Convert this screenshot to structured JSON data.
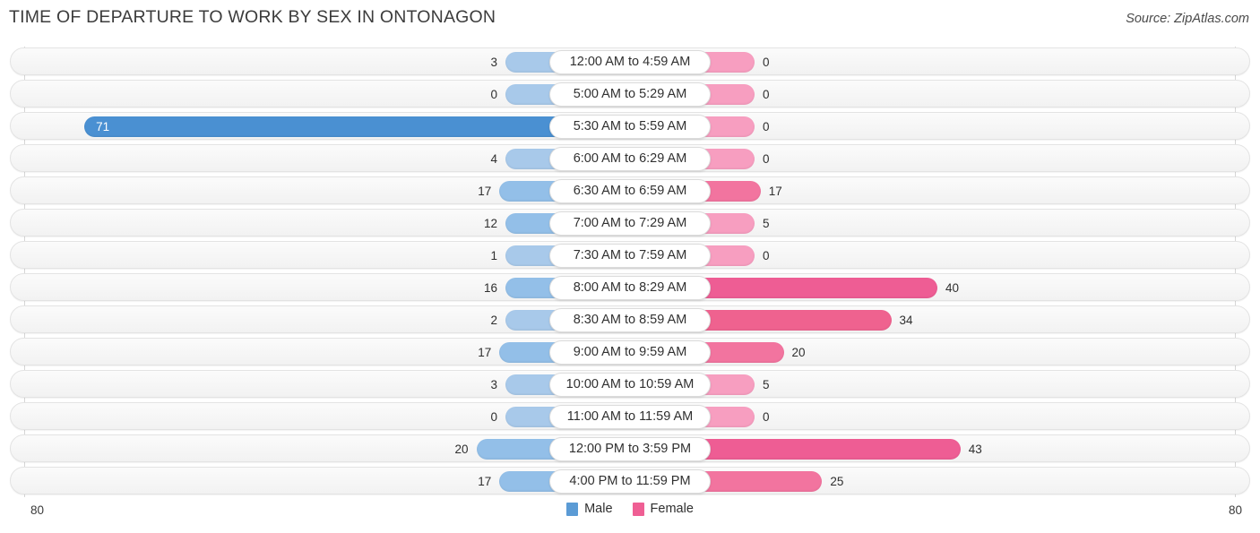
{
  "header": {
    "title": "TIME OF DEPARTURE TO WORK BY SEX IN ONTONAGON",
    "source": "Source: ZipAtlas.com"
  },
  "axis": {
    "left_label": "80",
    "right_label": "80"
  },
  "legend": {
    "items": [
      {
        "label": "Male",
        "color": "#5b9bd5"
      },
      {
        "label": "Female",
        "color": "#ef5f94"
      }
    ]
  },
  "chart_data": {
    "type": "bar",
    "subtype": "diverging-bidirectional",
    "title": "TIME OF DEPARTURE TO WORK BY SEX IN ONTONAGON",
    "xlabel": "",
    "ylabel": "",
    "xlim": [
      80,
      80
    ],
    "axis_max": 80,
    "grid": false,
    "legend_position": "bottom-center",
    "categories": [
      "12:00 AM to 4:59 AM",
      "5:00 AM to 5:29 AM",
      "5:30 AM to 5:59 AM",
      "6:00 AM to 6:29 AM",
      "6:30 AM to 6:59 AM",
      "7:00 AM to 7:29 AM",
      "7:30 AM to 7:59 AM",
      "8:00 AM to 8:29 AM",
      "8:30 AM to 8:59 AM",
      "9:00 AM to 9:59 AM",
      "10:00 AM to 10:59 AM",
      "11:00 AM to 11:59 AM",
      "12:00 PM to 3:59 PM",
      "4:00 PM to 11:59 PM"
    ],
    "series": [
      {
        "name": "Male",
        "direction": "left",
        "color": "#93bfe8",
        "values": [
          3,
          0,
          71,
          4,
          17,
          12,
          1,
          16,
          2,
          17,
          3,
          0,
          20,
          17
        ]
      },
      {
        "name": "Female",
        "direction": "right",
        "color": "#f79ec0",
        "values": [
          0,
          0,
          0,
          0,
          17,
          5,
          0,
          40,
          34,
          20,
          5,
          0,
          43,
          25
        ]
      }
    ]
  },
  "rows": [
    {
      "label": "12:00 AM to 4:59 AM",
      "male": 3,
      "female": 0,
      "male_color": "#a8c9ea",
      "female_color": "#f79ec0"
    },
    {
      "label": "5:00 AM to 5:29 AM",
      "male": 0,
      "female": 0,
      "male_color": "#a8c9ea",
      "female_color": "#f79ec0"
    },
    {
      "label": "5:30 AM to 5:59 AM",
      "male": 71,
      "female": 0,
      "male_color": "#4a90d2",
      "female_color": "#f79ec0"
    },
    {
      "label": "6:00 AM to 6:29 AM",
      "male": 4,
      "female": 0,
      "male_color": "#a8c9ea",
      "female_color": "#f79ec0"
    },
    {
      "label": "6:30 AM to 6:59 AM",
      "male": 17,
      "female": 17,
      "male_color": "#93bfe8",
      "female_color": "#f2749f"
    },
    {
      "label": "7:00 AM to 7:29 AM",
      "male": 12,
      "female": 5,
      "male_color": "#93bfe8",
      "female_color": "#f79ec0"
    },
    {
      "label": "7:30 AM to 7:59 AM",
      "male": 1,
      "female": 0,
      "male_color": "#a8c9ea",
      "female_color": "#f79ec0"
    },
    {
      "label": "8:00 AM to 8:29 AM",
      "male": 16,
      "female": 40,
      "male_color": "#93bfe8",
      "female_color": "#ee5d94"
    },
    {
      "label": "8:30 AM to 8:59 AM",
      "male": 2,
      "female": 34,
      "male_color": "#a8c9ea",
      "female_color": "#ef628f"
    },
    {
      "label": "9:00 AM to 9:59 AM",
      "male": 17,
      "female": 20,
      "male_color": "#93bfe8",
      "female_color": "#f2749f"
    },
    {
      "label": "10:00 AM to 10:59 AM",
      "male": 3,
      "female": 5,
      "male_color": "#a8c9ea",
      "female_color": "#f79ec0"
    },
    {
      "label": "11:00 AM to 11:59 AM",
      "male": 0,
      "female": 0,
      "male_color": "#a8c9ea",
      "female_color": "#f79ec0"
    },
    {
      "label": "12:00 PM to 3:59 PM",
      "male": 20,
      "female": 43,
      "male_color": "#93bfe8",
      "female_color": "#ee5d94"
    },
    {
      "label": "4:00 PM to 11:59 PM",
      "male": 17,
      "female": 25,
      "male_color": "#93bfe8",
      "female_color": "#f2749f"
    }
  ]
}
